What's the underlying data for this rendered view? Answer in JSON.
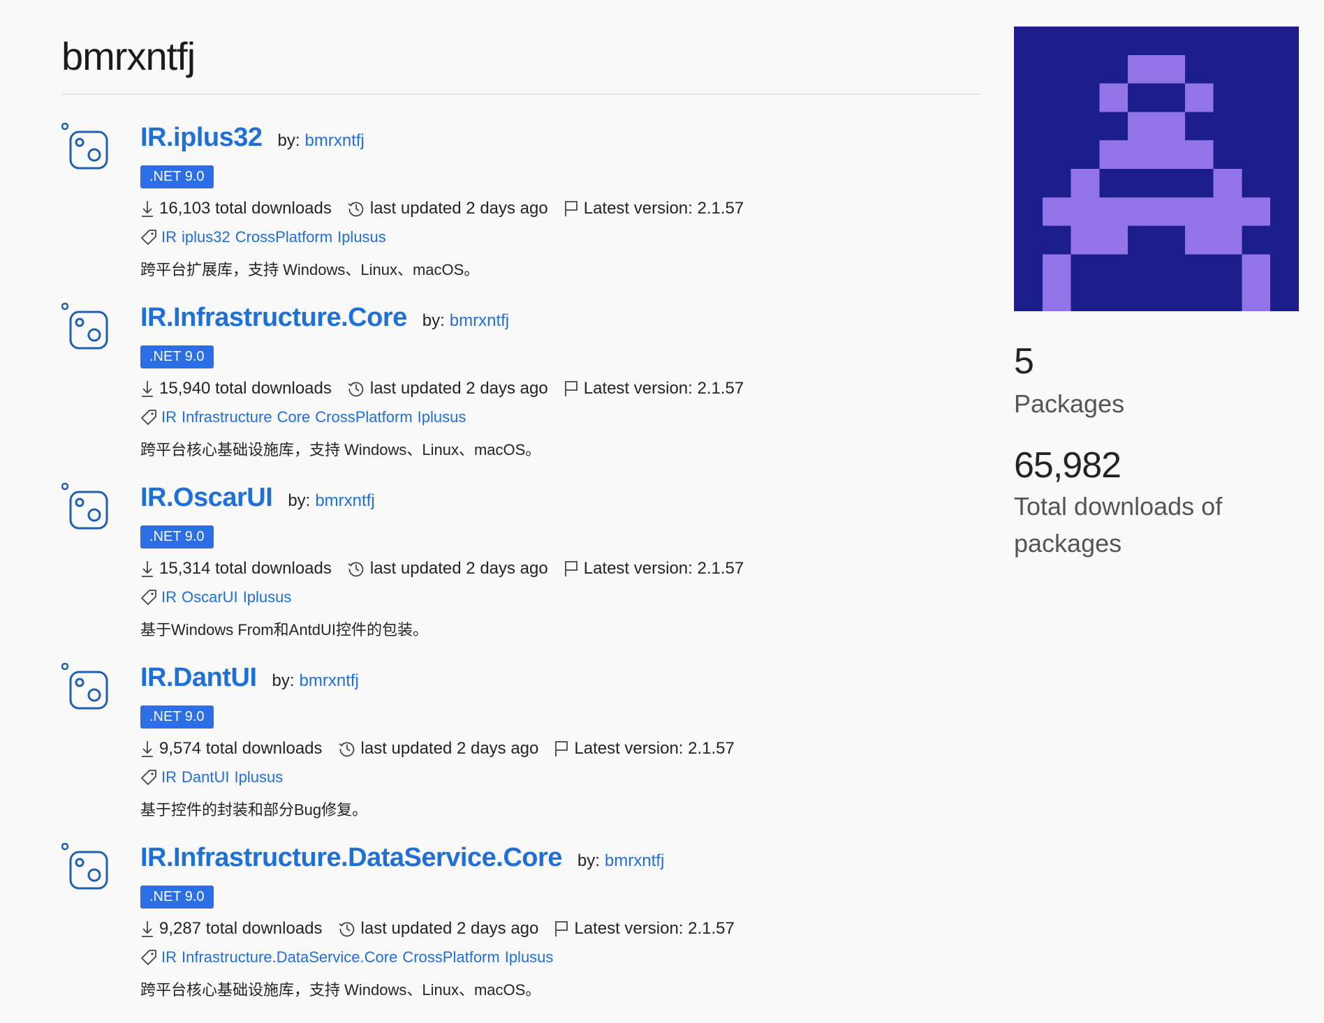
{
  "profile": {
    "username": "bmrxntfj"
  },
  "stats": {
    "package_count": "5",
    "package_label": "Packages",
    "total_downloads": "65,982",
    "total_downloads_label_1": "Total downloads of",
    "total_downloads_label_2": "packages"
  },
  "labels": {
    "by": "by:",
    "total_downloads_suffix": "total downloads",
    "last_updated": "last updated 2 days ago",
    "latest_version_prefix": "Latest version:"
  },
  "icons": {
    "package": "package-icon",
    "download": "download-icon",
    "history": "history-icon",
    "flag": "flag-icon",
    "tag": "tag-icon"
  },
  "colors": {
    "link": "#1f6fd8",
    "badge": "#2b6ee6",
    "avatar_bg": "#1b1e8c",
    "avatar_fg": "#9374e8"
  },
  "packages": [
    {
      "name": "IR.iplus32",
      "owner": "bmrxntfj",
      "framework": ".NET 9.0",
      "downloads": "16,103",
      "version": "2.1.57",
      "tags": [
        "IR",
        "iplus32",
        "CrossPlatform",
        "Iplusus"
      ],
      "description": "跨平台扩展库，支持 Windows、Linux、macOS。"
    },
    {
      "name": "IR.Infrastructure.Core",
      "owner": "bmrxntfj",
      "framework": ".NET 9.0",
      "downloads": "15,940",
      "version": "2.1.57",
      "tags": [
        "IR",
        "Infrastructure",
        "Core",
        "CrossPlatform",
        "Iplusus"
      ],
      "description": "跨平台核心基础设施库，支持 Windows、Linux、macOS。"
    },
    {
      "name": "IR.OscarUI",
      "owner": "bmrxntfj",
      "framework": ".NET 9.0",
      "downloads": "15,314",
      "version": "2.1.57",
      "tags": [
        "IR",
        "OscarUI",
        "Iplusus"
      ],
      "description": "基于Windows From和AntdUI控件的包装。"
    },
    {
      "name": "IR.DantUI",
      "owner": "bmrxntfj",
      "framework": ".NET 9.0",
      "downloads": "9,574",
      "version": "2.1.57",
      "tags": [
        "IR",
        "DantUI",
        "Iplusus"
      ],
      "description": "基于控件的封装和部分Bug修复。"
    },
    {
      "name": "IR.Infrastructure.DataService.Core",
      "owner": "bmrxntfj",
      "framework": ".NET 9.0",
      "downloads": "9,287",
      "version": "2.1.57",
      "tags": [
        "IR",
        "Infrastructure.DataService.Core",
        "CrossPlatform",
        "Iplusus"
      ],
      "description": "跨平台核心基础设施库，支持 Windows、Linux、macOS。"
    }
  ]
}
